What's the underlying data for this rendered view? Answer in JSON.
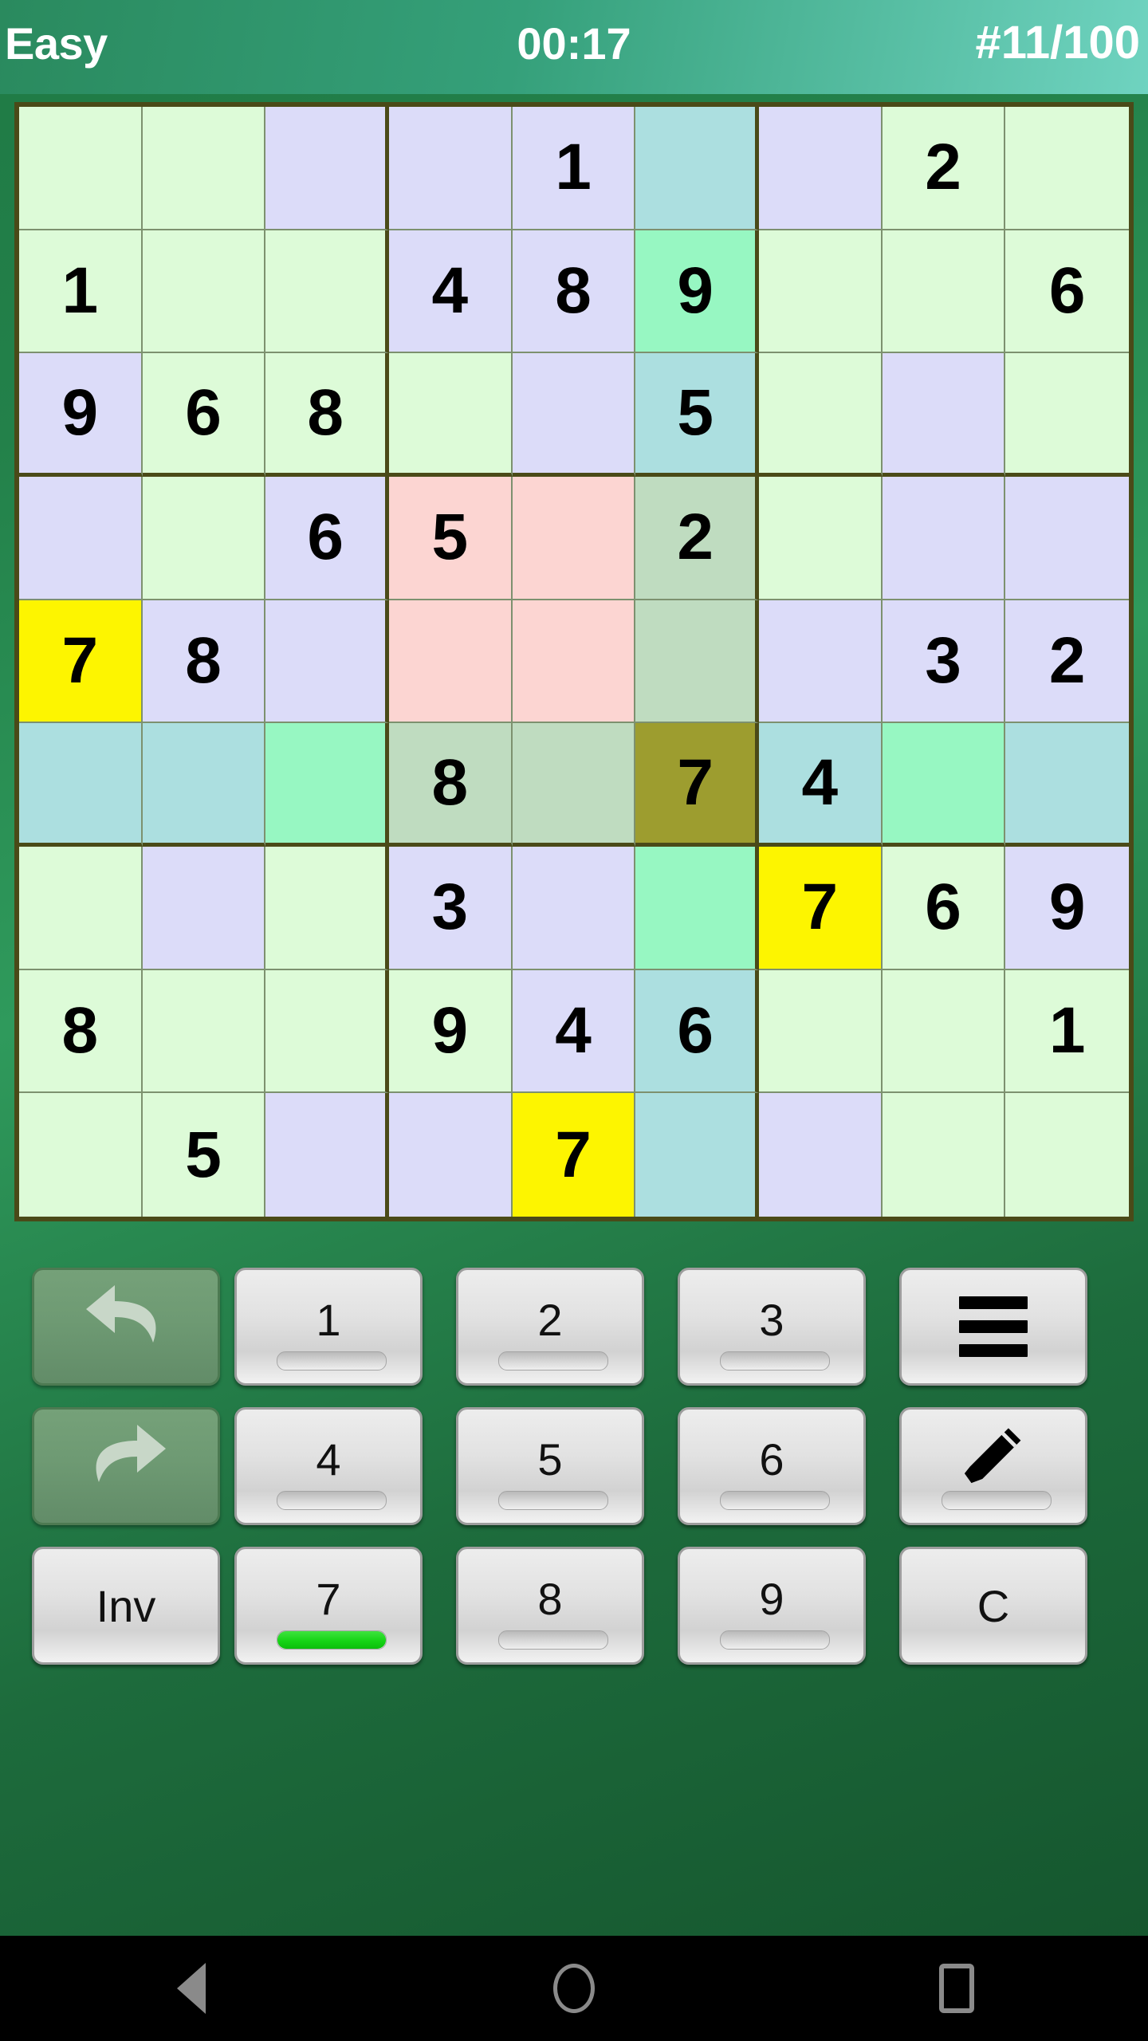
{
  "header": {
    "difficulty": "Easy",
    "timer": "00:17",
    "puzzle_index": "#11/100"
  },
  "colors": {
    "header_gradient_start": "#2a8a5e",
    "header_gradient_end": "#6fd3c0",
    "background_green": "#1d6b3c",
    "grid_line_bold": "#4a4a18",
    "grid_line_thin": "#7d916f",
    "cell_green": "#ddfbd8",
    "cell_lavender": "#dcdcf9",
    "cell_cyan": "#acdfe0",
    "cell_mint": "#97f7c2",
    "cell_sage": "#bfdcc0",
    "cell_pink": "#fcd5d2",
    "cell_yellow": "#fdf500",
    "cell_olive": "#9d9d2f",
    "progress_fill_green": "#16d416"
  },
  "board": {
    "rows": [
      [
        {
          "v": "",
          "c": "green"
        },
        {
          "v": "",
          "c": "green"
        },
        {
          "v": "",
          "c": "lav"
        },
        {
          "v": "",
          "c": "lav"
        },
        {
          "v": "1",
          "c": "lav"
        },
        {
          "v": "",
          "c": "cyan"
        },
        {
          "v": "",
          "c": "lav"
        },
        {
          "v": "2",
          "c": "green"
        },
        {
          "v": "",
          "c": "green"
        }
      ],
      [
        {
          "v": "1",
          "c": "green"
        },
        {
          "v": "",
          "c": "green"
        },
        {
          "v": "",
          "c": "green"
        },
        {
          "v": "4",
          "c": "lav"
        },
        {
          "v": "8",
          "c": "lav"
        },
        {
          "v": "9",
          "c": "mint"
        },
        {
          "v": "",
          "c": "green"
        },
        {
          "v": "",
          "c": "green"
        },
        {
          "v": "6",
          "c": "green"
        }
      ],
      [
        {
          "v": "9",
          "c": "lav"
        },
        {
          "v": "6",
          "c": "green"
        },
        {
          "v": "8",
          "c": "green"
        },
        {
          "v": "",
          "c": "green"
        },
        {
          "v": "",
          "c": "lav"
        },
        {
          "v": "5",
          "c": "cyan"
        },
        {
          "v": "",
          "c": "green"
        },
        {
          "v": "",
          "c": "lav"
        },
        {
          "v": "",
          "c": "green"
        }
      ],
      [
        {
          "v": "",
          "c": "lav"
        },
        {
          "v": "",
          "c": "green"
        },
        {
          "v": "6",
          "c": "lav"
        },
        {
          "v": "5",
          "c": "pink"
        },
        {
          "v": "",
          "c": "pink"
        },
        {
          "v": "2",
          "c": "sage"
        },
        {
          "v": "",
          "c": "green"
        },
        {
          "v": "",
          "c": "lav"
        },
        {
          "v": "",
          "c": "lav"
        }
      ],
      [
        {
          "v": "7",
          "c": "yellow"
        },
        {
          "v": "8",
          "c": "lav"
        },
        {
          "v": "",
          "c": "lav"
        },
        {
          "v": "",
          "c": "pink"
        },
        {
          "v": "",
          "c": "pink"
        },
        {
          "v": "",
          "c": "sage"
        },
        {
          "v": "",
          "c": "lav"
        },
        {
          "v": "3",
          "c": "lav"
        },
        {
          "v": "2",
          "c": "lav"
        }
      ],
      [
        {
          "v": "",
          "c": "cyan"
        },
        {
          "v": "",
          "c": "cyan"
        },
        {
          "v": "",
          "c": "mint"
        },
        {
          "v": "8",
          "c": "sage"
        },
        {
          "v": "",
          "c": "sage"
        },
        {
          "v": "7",
          "c": "olive"
        },
        {
          "v": "4",
          "c": "cyan"
        },
        {
          "v": "",
          "c": "mint"
        },
        {
          "v": "",
          "c": "cyan"
        }
      ],
      [
        {
          "v": "",
          "c": "green"
        },
        {
          "v": "",
          "c": "lav"
        },
        {
          "v": "",
          "c": "green"
        },
        {
          "v": "3",
          "c": "lav"
        },
        {
          "v": "",
          "c": "lav"
        },
        {
          "v": "",
          "c": "mint"
        },
        {
          "v": "7",
          "c": "yellow"
        },
        {
          "v": "6",
          "c": "green"
        },
        {
          "v": "9",
          "c": "lav"
        }
      ],
      [
        {
          "v": "8",
          "c": "green"
        },
        {
          "v": "",
          "c": "green"
        },
        {
          "v": "",
          "c": "green"
        },
        {
          "v": "9",
          "c": "green"
        },
        {
          "v": "4",
          "c": "lav"
        },
        {
          "v": "6",
          "c": "cyan"
        },
        {
          "v": "",
          "c": "green"
        },
        {
          "v": "",
          "c": "green"
        },
        {
          "v": "1",
          "c": "green"
        }
      ],
      [
        {
          "v": "",
          "c": "green"
        },
        {
          "v": "5",
          "c": "green"
        },
        {
          "v": "",
          "c": "lav"
        },
        {
          "v": "",
          "c": "lav"
        },
        {
          "v": "7",
          "c": "yellow"
        },
        {
          "v": "",
          "c": "cyan"
        },
        {
          "v": "",
          "c": "lav"
        },
        {
          "v": "",
          "c": "green"
        },
        {
          "v": "",
          "c": "green"
        }
      ]
    ]
  },
  "keypad": {
    "rows": [
      [
        {
          "name": "undo-button",
          "label": "",
          "icon": "undo-icon",
          "style": "dim",
          "progress": null
        },
        {
          "name": "digit-1-button",
          "label": "1",
          "icon": null,
          "style": "light",
          "progress": 0
        },
        {
          "name": "digit-2-button",
          "label": "2",
          "icon": null,
          "style": "light",
          "progress": 0
        },
        {
          "name": "digit-3-button",
          "label": "3",
          "icon": null,
          "style": "light",
          "progress": 0
        },
        {
          "name": "menu-button",
          "label": "",
          "icon": "hamburger-icon",
          "style": "light",
          "progress": null
        }
      ],
      [
        {
          "name": "redo-button",
          "label": "",
          "icon": "redo-icon",
          "style": "dim",
          "progress": null
        },
        {
          "name": "digit-4-button",
          "label": "4",
          "icon": null,
          "style": "light",
          "progress": 0
        },
        {
          "name": "digit-5-button",
          "label": "5",
          "icon": null,
          "style": "light",
          "progress": 0
        },
        {
          "name": "digit-6-button",
          "label": "6",
          "icon": null,
          "style": "light",
          "progress": 0
        },
        {
          "name": "pencil-button",
          "label": "",
          "icon": "pencil-icon",
          "style": "light",
          "progress": 0
        }
      ],
      [
        {
          "name": "invert-button",
          "label": "Inv",
          "icon": null,
          "style": "light",
          "progress": null
        },
        {
          "name": "digit-7-button",
          "label": "7",
          "icon": null,
          "style": "light",
          "progress": 100
        },
        {
          "name": "digit-8-button",
          "label": "8",
          "icon": null,
          "style": "light",
          "progress": 0
        },
        {
          "name": "digit-9-button",
          "label": "9",
          "icon": null,
          "style": "light",
          "progress": 0
        },
        {
          "name": "clear-button",
          "label": "C",
          "icon": null,
          "style": "light",
          "progress": null
        }
      ]
    ]
  },
  "navbar": {
    "back_label": "back-icon",
    "home_label": "home-icon",
    "recents_label": "recents-icon"
  }
}
